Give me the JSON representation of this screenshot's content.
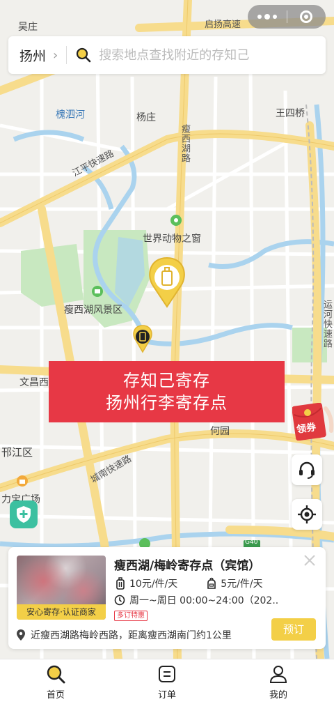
{
  "map": {
    "labels": {
      "wuzhuang": "吴庄",
      "qiyang_expressway": "启扬高速",
      "huaisihe": "槐泗河",
      "yangzhuang": "杨庄",
      "wangsiqiao": "王四桥",
      "shouxihu_road": "瘦西湖路",
      "jiangping_expressway": "江平快速路",
      "world_zoo": "世界动物之窗",
      "shouxihu_scenic": "瘦西湖风景区",
      "yunhe_expressway": "运河快速路",
      "wenchang_west": "文昌西",
      "heyuan": "何园",
      "hanjiang_district": "邗江区",
      "chengnan_expressway": "城南快速路",
      "libao_plaza": "力宝广场",
      "g40": "G40"
    }
  },
  "capsule": {
    "menu_icon": "more-dots-icon",
    "close_icon": "target-circle-icon"
  },
  "search": {
    "city": "扬州",
    "placeholder": "搜索地点查找附近的存知己"
  },
  "banner": {
    "line1": "存知己寄存",
    "line2": "扬州行李寄存点"
  },
  "floating": {
    "coupon_label": "领券",
    "service_icon": "headset-icon",
    "locate_icon": "crosshair-icon",
    "safety_icon": "shield-plus-icon"
  },
  "card": {
    "title": "瘦西湖/梅岭寄存点（宾馆）",
    "thumb_tag": "安心寄存·认证商家",
    "price_luggage": "10元/件/天",
    "price_bag": "5元/件/天",
    "hours": "周一~周日 00:00~24:00（202...",
    "special_tag": "多订特惠",
    "address": "近瘦西湖路梅岭西路，距离瘦西湖南门约1公里",
    "book_label": "预订"
  },
  "tabs": [
    {
      "label": "首页",
      "icon": "search-icon"
    },
    {
      "label": "订单",
      "icon": "order-icon"
    },
    {
      "label": "我的",
      "icon": "user-icon"
    }
  ],
  "colors": {
    "accent_yellow": "#f3cf47",
    "banner_red": "#e73845",
    "road_yellow": "#f7dc8c",
    "water_blue": "#aad3ee",
    "park_green": "#c8e8c0"
  }
}
